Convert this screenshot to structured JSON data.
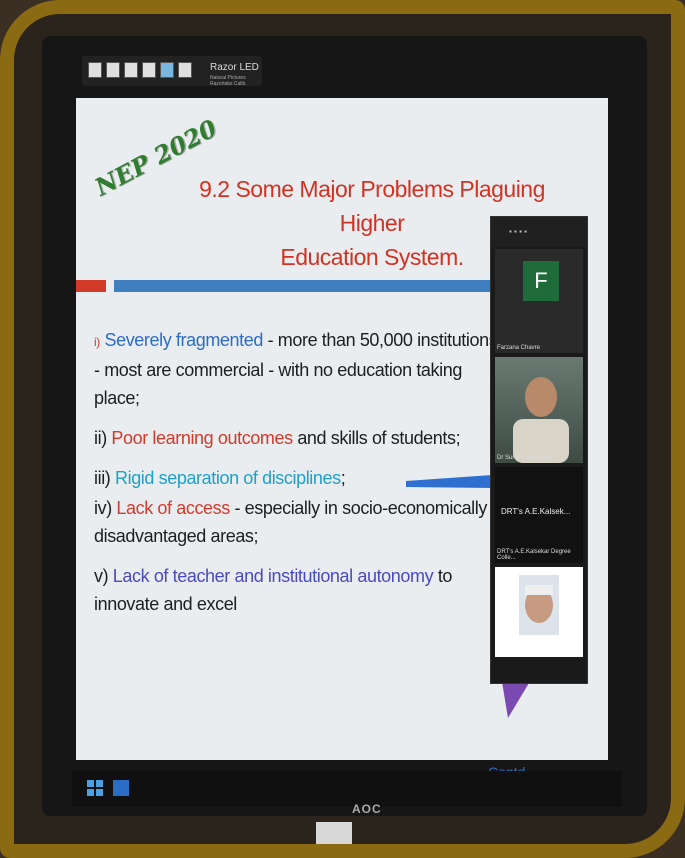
{
  "toolbar": {
    "label": "Razor LED",
    "sublabel": "Natural Pictures Razorlabs Calib."
  },
  "slide": {
    "badge": "NEP 2020",
    "title_line1": "9.2 Some Major Problems Plaguing Higher",
    "title_line2": "Education System.",
    "items": {
      "i_marker": "i)",
      "i_highlight": "Severely fragmented",
      "i_rest": " -  more than 50,000 institutions -  most are commercial - with no education  taking place;",
      "ii_marker": "ii) ",
      "ii_highlight": "Poor learning outcomes",
      "ii_rest": " and skills of students;",
      "iii_marker": "iii) ",
      "iii_highlight": "Rigid separation of disciplines",
      "iii_rest": ";",
      "iv_marker": "iv) ",
      "iv_highlight": "Lack of access",
      "iv_rest": "  - especially in socio-economically disadvantaged areas;",
      "v_marker": "v) ",
      "v_highlight": "Lack of teacher and institutional autonomy",
      "v_rest": " to innovate and excel"
    },
    "contd": "Contd.."
  },
  "video_call": {
    "tile1_initial": "F",
    "tile1_name": "Farzana Chavre",
    "tile2_name": "Dr Suresh Srivastava",
    "tile3_title": "DRT's A.E.Kalsek...",
    "tile3_name": "DRT's A.E.Kalsekar Degree Colle..."
  },
  "monitor": {
    "brand": "AOC"
  },
  "colors": {
    "frame": "#8a6a12",
    "title": "#d23222",
    "highlight_blue": "#2b6cc4",
    "nep_green": "#2f7d2f"
  }
}
